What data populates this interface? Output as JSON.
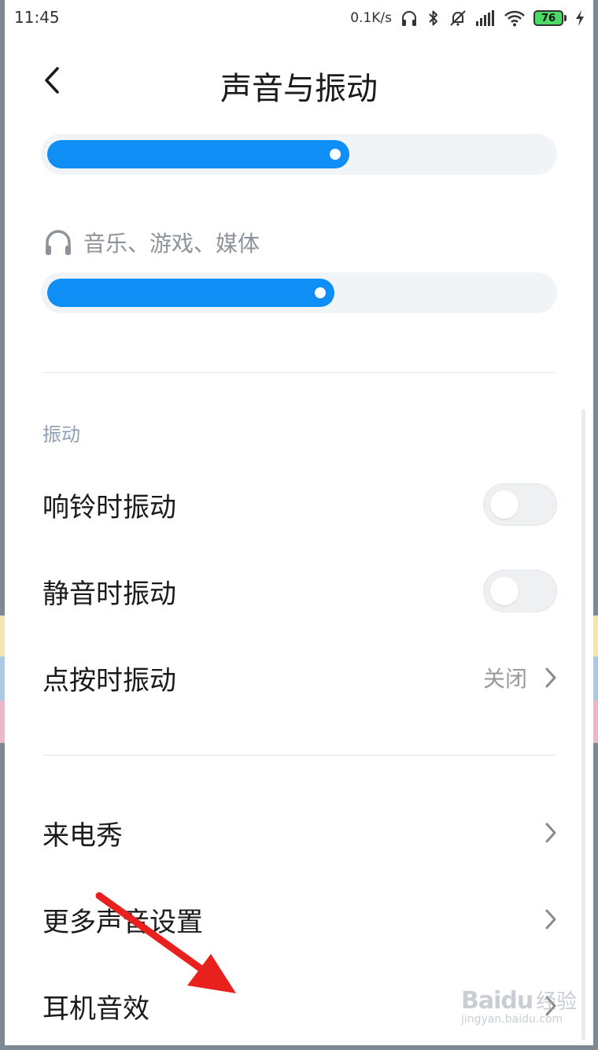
{
  "status_bar": {
    "time": "11:45",
    "net_speed": "0.1K/s",
    "battery": "76"
  },
  "header": {
    "title": "声音与振动"
  },
  "sliders": {
    "ring_volume_fraction": 0.6,
    "media_volume_fraction": 0.57,
    "media_label": "音乐、游戏、媒体"
  },
  "vibration": {
    "section_title": "振动",
    "ring_vibrate": {
      "label": "响铃时振动",
      "enabled": false
    },
    "silent_vibrate": {
      "label": "静音时振动",
      "enabled": false
    },
    "touch_vibrate": {
      "label": "点按时振动",
      "value": "关闭"
    }
  },
  "more": {
    "caller_show": "来电秀",
    "more_sound_settings": "更多声音设置",
    "headphone_effects": "耳机音效"
  },
  "watermark": {
    "brand": "Baidu",
    "brand_cn": "经验",
    "url": "jingyan.baidu.com"
  },
  "colors": {
    "accent": "#0f8ef5",
    "annotation_arrow": "#e8201e"
  }
}
